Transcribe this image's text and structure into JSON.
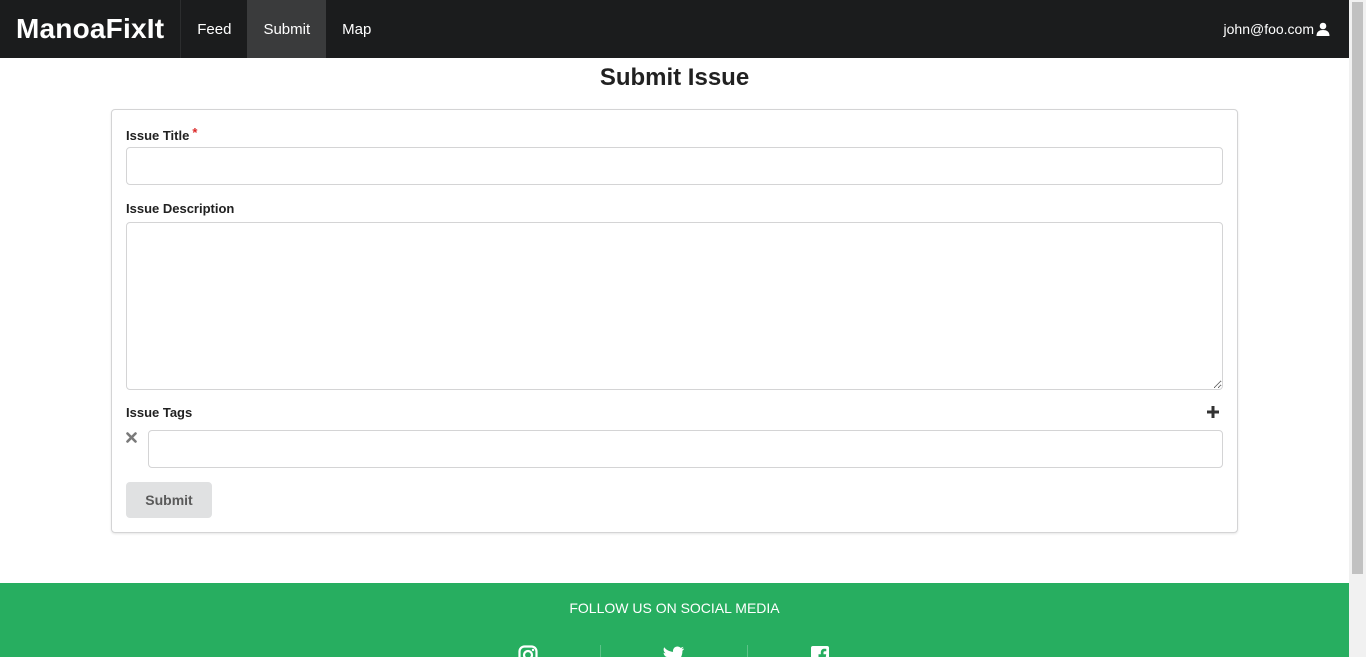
{
  "navbar": {
    "brand": "ManoaFixIt",
    "items": [
      {
        "label": "Feed"
      },
      {
        "label": "Submit"
      },
      {
        "label": "Map"
      }
    ],
    "user_email": "john@foo.com"
  },
  "page": {
    "title": "Submit Issue"
  },
  "form": {
    "title_label": "Issue Title",
    "required_mark": "*",
    "title_value": "",
    "description_label": "Issue Description",
    "description_value": "",
    "tags_label": "Issue Tags",
    "tag_value": "",
    "submit_label": "Submit"
  },
  "footer": {
    "heading": "FOLLOW US ON SOCIAL MEDIA",
    "icons": [
      "instagram-icon",
      "twitter-icon",
      "facebook-icon"
    ]
  },
  "colors": {
    "navbar": "#1b1c1d",
    "footer": "#27ae60",
    "required": "#db2828"
  }
}
